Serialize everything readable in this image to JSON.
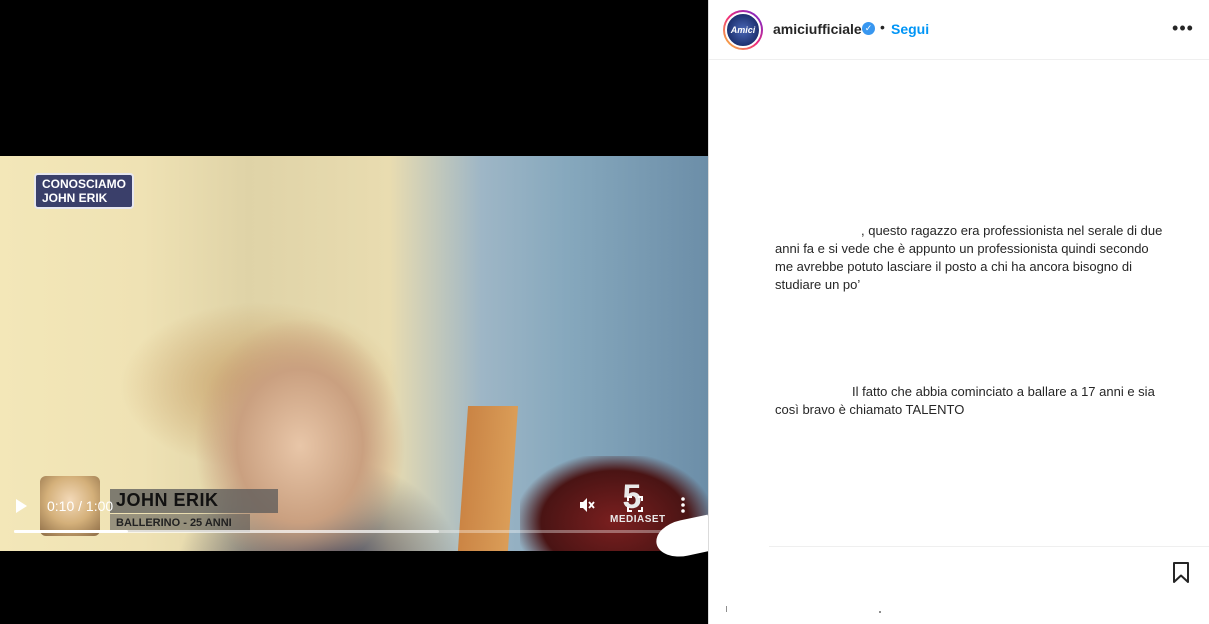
{
  "video": {
    "overlay_tag_line1": "CONOSCIAMO",
    "overlay_tag_line2": "JOHN ERIK",
    "lower_third_name": "JOHN ERIK",
    "lower_third_role": "BALLERINO - 25 ANNI",
    "broadcaster_logo_number": "5",
    "broadcaster_logo_text": "MEDIASET",
    "time_display": "0:10 / 1:00",
    "progress_fraction": 0.1667,
    "buffered_fraction": 0.62,
    "controls": {
      "play_icon": "play-icon",
      "mute_icon": "muted-speaker-icon",
      "fullscreen_icon": "fullscreen-icon",
      "more_icon": "vertical-ellipsis-icon"
    }
  },
  "post": {
    "username": "amiciufficiale",
    "verified": true,
    "separator": "•",
    "follow_label": "Segui",
    "options_label": "•••",
    "avatar_text": "Amici"
  },
  "comments": [
    {
      "text": ", questo ragazzo era professionista nel serale di due anni fa e si vede che è appunto un professionista quindi secondo me avrebbe potuto lasciare il posto a chi ha ancora bisogno di studiare un po’"
    },
    {
      "text": "Il fatto che abbia cominciato a ballare a 17 anni e sia così bravo è chiamato TALENTO"
    }
  ],
  "colors": {
    "accent": "#0095f6",
    "verified": "#3897f0",
    "text": "#262626"
  }
}
